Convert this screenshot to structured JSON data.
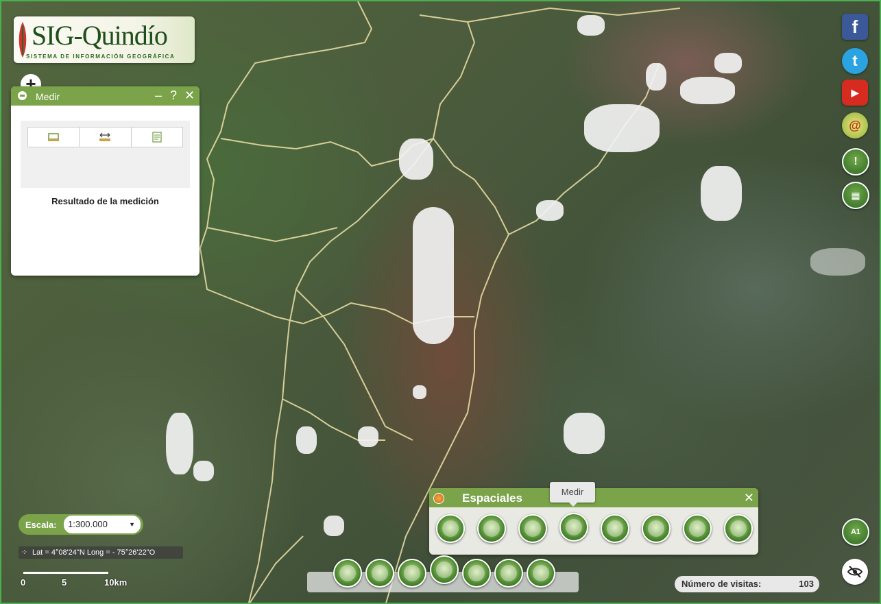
{
  "logo": {
    "title": "SIG-Quindío",
    "subtitle": "SISTEMA DE INFORMACIÓN GEOGRÁFICA"
  },
  "zoom": {
    "plus_label": "+"
  },
  "measure_panel": {
    "title": "Medir",
    "minimize": "–",
    "help": "?",
    "close": "✕",
    "tools": [
      {
        "icon": "area-measure-icon"
      },
      {
        "icon": "distance-measure-icon"
      },
      {
        "icon": "location-measure-icon"
      }
    ],
    "result_label": "Resultado de la medición"
  },
  "social": {
    "facebook_label": "f",
    "twitter_label": "t",
    "youtube_label": "▶",
    "email_label": "@"
  },
  "side_buttons": {
    "info_label": "!",
    "calc_label": "▦"
  },
  "espaciales": {
    "title": "Espaciales",
    "close": "✕",
    "tools": [
      {
        "icon": "map-layers-icon"
      },
      {
        "icon": "building-icon"
      },
      {
        "icon": "region-icon"
      },
      {
        "icon": "ruler-icon"
      },
      {
        "icon": "map-analysis-icon"
      },
      {
        "icon": "compass-icon"
      },
      {
        "icon": "camera-icon"
      },
      {
        "icon": "shape-icon"
      }
    ]
  },
  "tooltip": {
    "text": "Medir"
  },
  "bottom_toolbar": {
    "tools": [
      {
        "icon": "legend-icon"
      },
      {
        "icon": "coordinate-icon"
      },
      {
        "icon": "folder-icon"
      },
      {
        "icon": "open-folder-icon"
      },
      {
        "icon": "print-icon"
      },
      {
        "icon": "swipe-icon"
      },
      {
        "icon": "basemap-icon"
      }
    ]
  },
  "scale": {
    "label": "Escala:",
    "value": "1:300.000"
  },
  "coords": {
    "text": "Lat = 4°08'24\"N Long = - 75°26'22\"O"
  },
  "scalebar": {
    "labels": [
      "0",
      "5",
      "10km"
    ]
  },
  "visits": {
    "label": "Número de visitas:",
    "value": "103"
  },
  "overview": {
    "label": "A1"
  }
}
